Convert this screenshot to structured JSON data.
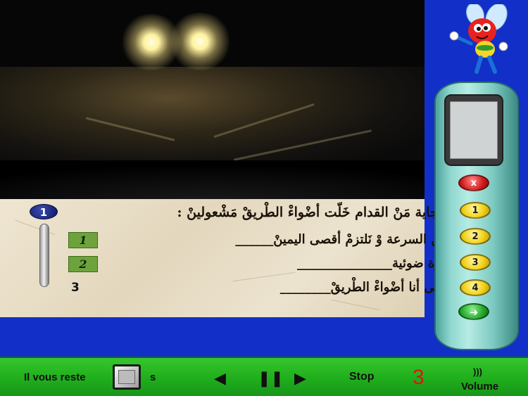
{
  "question": {
    "number": "1",
    "text": "العربة لِّلي جاية مَنْ القدام خَلّت أضْواءْ الطْريقْ مَشْعولينْ :",
    "answers": [
      {
        "label": "1",
        "text": "ـ ننقص من السرعة وْ نَلتزمْ أقصى اليمينْ______"
      },
      {
        "label": "2",
        "text": "ـ نَبِّهْ بإشارة ضوئية_______________"
      },
      {
        "label": "3",
        "text": "ـ نْشْعَل حَتّى أنا أضْواءْ الطْريقْ________"
      }
    ]
  },
  "remote": {
    "cancel_symbol": "x",
    "buttons": [
      "1",
      "2",
      "3",
      "4"
    ],
    "validate_symbol": "➔"
  },
  "controls": {
    "remaining_label": "Il vous reste",
    "seconds_unit": "s",
    "prev_symbol": "◀",
    "pause_symbol": "❚❚",
    "next_symbol": "▶",
    "stop_label": "Stop",
    "counter": "3",
    "volume_waves": ")))",
    "volume_label": "Volume"
  },
  "colors": {
    "background": "#1230c8",
    "bar": "#1fae1c",
    "counter": "#e01414",
    "answer_label_bg": "#6da33c"
  }
}
